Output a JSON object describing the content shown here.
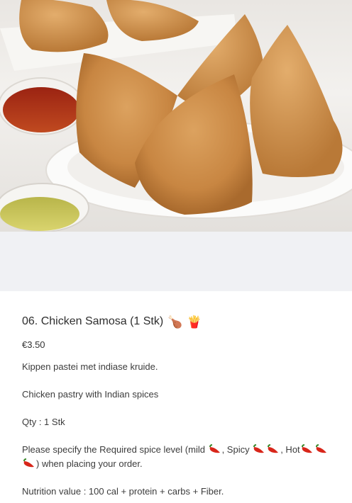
{
  "product": {
    "title": "06. Chicken Samosa (1 Stk)",
    "title_icons": [
      "chicken-leg-icon",
      "fries-icon"
    ],
    "price": "€3.50",
    "description": {
      "dutch": "Kippen pastei met indiase kruide.",
      "english": "Chicken pastry with Indian spices",
      "qty": "Qty : 1 Stk",
      "spice_part1": "Please specify the Required spice level (mild ",
      "spice_part2": ", Spicy ",
      "spice_part3": ", Hot",
      "spice_part4": ") when placing your order.",
      "nutrition": "Nutrition value : 100 cal + protein + carbs + Fiber."
    }
  },
  "colors": {
    "accent_chili": "#d8261a",
    "hero_background": "#ece9e5",
    "spacer_background": "#f0f1f4"
  }
}
